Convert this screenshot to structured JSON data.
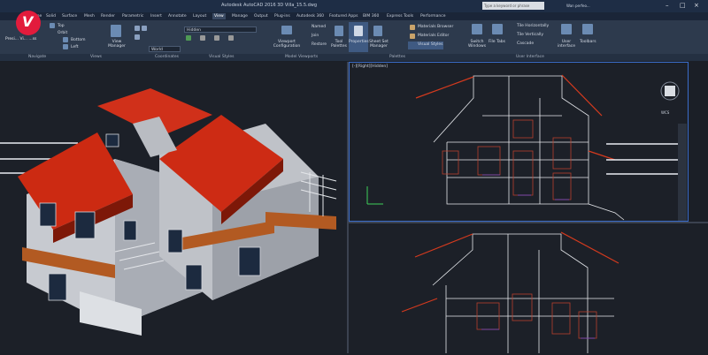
{
  "window": {
    "title": "Autodesk AutoCAD 2016   3D Villa_15.5.dwg",
    "search_placeholder": "Type a keyword or phrase",
    "user": "Wan perfeo..."
  },
  "ribbon_tabs": [
    "Home",
    "Solid",
    "Surface",
    "Mesh",
    "Render",
    "Parametric",
    "Insert",
    "Annotate",
    "Layout",
    "View",
    "Manage",
    "Output",
    "Plug-ins",
    "Autodesk 360",
    "Featured Apps",
    "BIM 360",
    "Express Tools",
    "Performance"
  ],
  "active_tab": "View",
  "ribbon": {
    "menu_label": "Presi... Vi... ...ss",
    "viewport_tools": [
      "Top",
      "Orbit",
      "Bottom",
      "Left"
    ],
    "view_manager": "View Manager",
    "coord_world": "World",
    "visual_style": "Hidden",
    "model_viewports": {
      "config": "Viewport Configuration",
      "named": "Named",
      "join": "Join",
      "restore": "Restore"
    },
    "palettes": {
      "tool": "Tool Palettes",
      "properties": "Properties",
      "sheet_set": "Sheet Set Manager",
      "materials_browser": "Materials Browser",
      "materials_editor": "Materials Editor",
      "visual_styles": "Visual Styles"
    },
    "ui": {
      "switch": "Switch Windows",
      "file_tabs": "File Tabs",
      "tile_h": "Tile Horizontally",
      "tile_v": "Tile Vertically",
      "cascade": "Cascade",
      "user_interface": "User interface",
      "toolbars": "Toolbars"
    },
    "panel_labels": [
      "Navigate",
      "Views",
      "Coordinates",
      "Visual Styles",
      "Model Viewports",
      "Palettes",
      "User Interface"
    ]
  },
  "viewports": {
    "active_label": "[-][Right][Hidden]",
    "wcs": "WCS"
  },
  "logo_letter": "V",
  "colors": {
    "accent": "#e21b3c",
    "roof": "#d42a12",
    "viewport_border": "#3a6cc9"
  }
}
